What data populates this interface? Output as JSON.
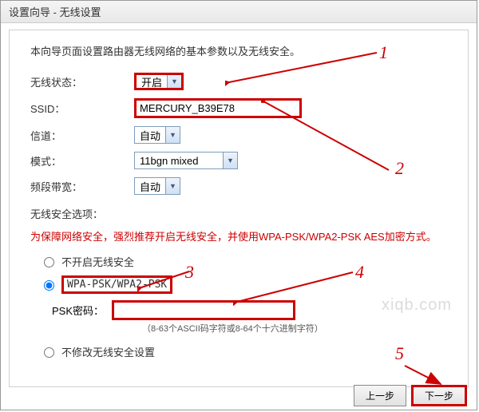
{
  "title": "设置向导 - 无线设置",
  "intro": "本向导页面设置路由器无线网络的基本参数以及无线安全。",
  "fields": {
    "wireless_status": {
      "label": "无线状态：",
      "value": "开启"
    },
    "ssid": {
      "label": "SSID：",
      "value": "MERCURY_B39E78"
    },
    "channel": {
      "label": "信道：",
      "value": "自动"
    },
    "mode": {
      "label": "模式：",
      "value": "11bgn mixed"
    },
    "bandwidth": {
      "label": "频段带宽：",
      "value": "自动"
    }
  },
  "security": {
    "section_label": "无线安全选项：",
    "warning": "为保障网络安全，强烈推荐开启无线安全，并使用WPA-PSK/WPA2-PSK AES加密方式。",
    "opt_disable": "不开启无线安全",
    "opt_wpa": "WPA-PSK/WPA2-PSK",
    "opt_keep": "不修改无线安全设置",
    "psk_label": "PSK密码：",
    "psk_value": "",
    "psk_hint": "（8-63个ASCII码字符或8-64个十六进制字符）"
  },
  "buttons": {
    "prev": "上一步",
    "next": "下一步"
  },
  "annotations": {
    "a1": "1",
    "a2": "2",
    "a3": "3",
    "a4": "4",
    "a5": "5"
  },
  "watermark": "xiqb.com"
}
